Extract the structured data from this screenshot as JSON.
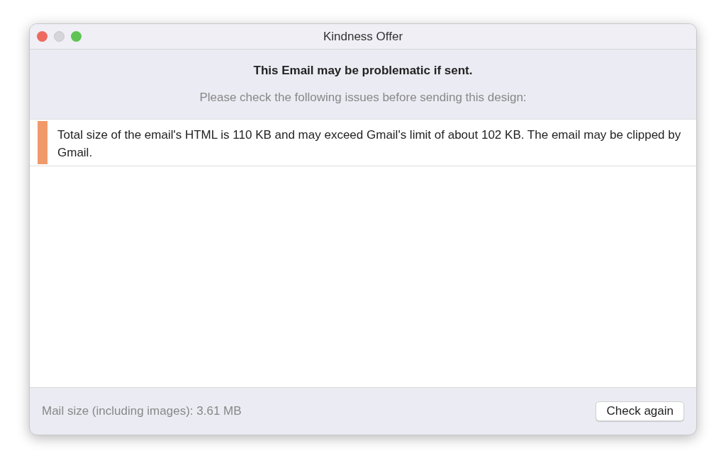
{
  "window": {
    "title": "Kindness Offer"
  },
  "header": {
    "heading": "This Email may be problematic if sent.",
    "subheading": "Please check the following issues before sending this design:"
  },
  "issues": [
    {
      "text": "Total size of the email's HTML is 110 KB and may exceed Gmail's limit of about 102 KB. The email may be clipped by Gmail.",
      "color": "#f0996b"
    }
  ],
  "footer": {
    "mail_size": "Mail size (including images): 3.61 MB",
    "button": "Check again"
  }
}
